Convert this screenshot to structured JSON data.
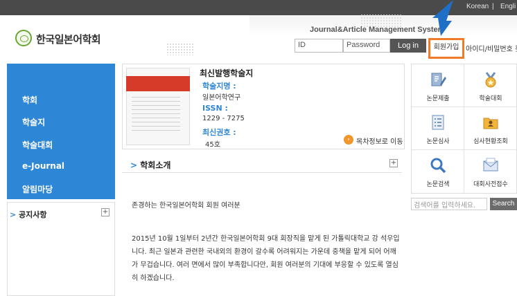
{
  "topbar": {
    "lang_korean": "Korean",
    "lang_sep": "|",
    "lang_english": "Engli"
  },
  "brand": {
    "name": "한국일본어학회"
  },
  "header": {
    "system_title": "Journal&Article Management System",
    "id_placeholder": "ID",
    "password_placeholder": "Password",
    "login_label": "Log in",
    "join_label": "회원가입",
    "find_label": "아이디/비밀번호 찾기"
  },
  "sidebar": {
    "items": [
      {
        "label": "학회"
      },
      {
        "label": "학술지"
      },
      {
        "label": "학술대회"
      },
      {
        "label": "e-Journal"
      },
      {
        "label": "알림마당"
      }
    ],
    "notice": {
      "title": "공지사항",
      "more": "+"
    }
  },
  "journal": {
    "heading": "최신발행학술지",
    "name_label": "학술지명 :",
    "name_value": "일본어학연구",
    "issn_label": "ISSN :",
    "issn_value": "1229 - 7275",
    "issue_label": "최신권호 :",
    "issue_value": "45호",
    "toc_link": "목차정보로 이동"
  },
  "about": {
    "title": "학회소개",
    "more": "+",
    "greeting": "존경하는 한국일본어학회 회원 여러분",
    "paragraph": "2015년 10월 1일부터 2년간 한국일본어학회 9대 회장직을 맡게 된 가톨릭대학교 강 석우입니다. 최근 일본과 관련한 국내외의 환경이 갈수록 어려워지는 가운데 중책을 맡게 되어 어깨가 무겁습니다. 여러 면에서 많이 부족합니다만, 회원 여러분의 기대에 부응할 수 있도록 열심히 하겠습니다."
  },
  "quick_menu": [
    {
      "label": "논문제출",
      "icon": "document-pencil-icon"
    },
    {
      "label": "학술대회",
      "icon": "medal-icon"
    },
    {
      "label": "논문심사",
      "icon": "checklist-icon"
    },
    {
      "label": "심사현황조회",
      "icon": "folder-person-icon"
    },
    {
      "label": "논문검색",
      "icon": "magnifier-icon"
    },
    {
      "label": "대회사전접수",
      "icon": "envelope-icon"
    }
  ],
  "search": {
    "placeholder": "검색어를 입력하세요.",
    "button": "Search"
  },
  "colors": {
    "sidebar": "#2e86d6",
    "accent": "#f07c2a",
    "topbar": "#4a4a4a"
  }
}
